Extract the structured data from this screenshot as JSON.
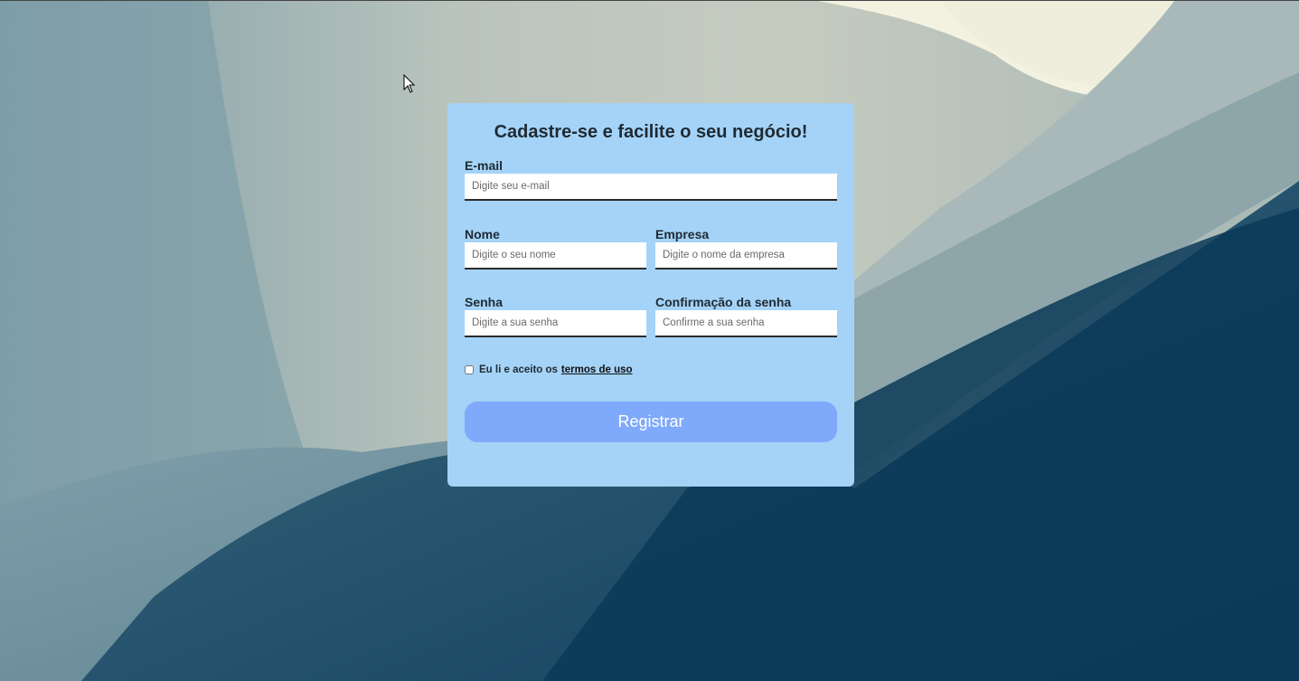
{
  "form": {
    "title": "Cadastre-se e facilite o seu negócio!",
    "email": {
      "label": "E-mail",
      "placeholder": "Digite seu e-mail",
      "value": ""
    },
    "name": {
      "label": "Nome",
      "placeholder": "Digite o seu nome",
      "value": ""
    },
    "company": {
      "label": "Empresa",
      "placeholder": "Digite o nome da empresa",
      "value": ""
    },
    "password": {
      "label": "Senha",
      "placeholder": "Digite a sua senha",
      "value": ""
    },
    "password_confirm": {
      "label": "Confirmação da senha",
      "placeholder": "Confirme a sua senha",
      "value": ""
    },
    "terms": {
      "text": "Eu li e aceito os",
      "link": "termos de uso",
      "checked": false
    },
    "submit_label": "Registrar"
  },
  "colors": {
    "card": "#a4d3f7",
    "button": "#7fa9fb",
    "text": "#1f2a33"
  },
  "icons": [
    "mouse-cursor-icon"
  ]
}
